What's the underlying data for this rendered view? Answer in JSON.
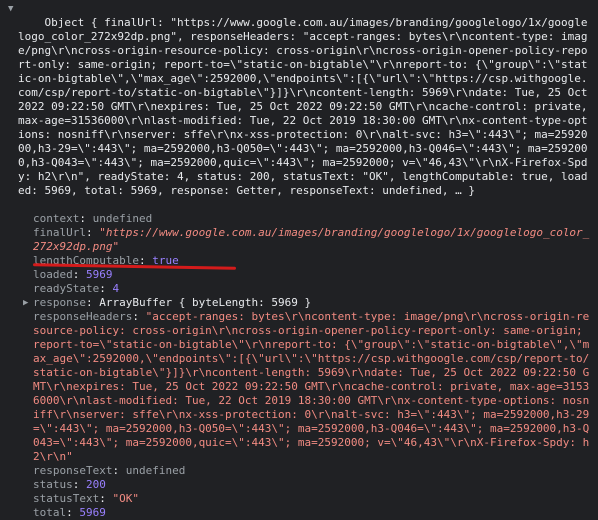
{
  "summary": {
    "text": "Object { finalUrl: \"https://www.google.com.au/images/branding/googlelogo/1x/googlelogo_color_272x92dp.png\", responseHeaders: \"accept-ranges: bytes\\r\\ncontent-type: image/png\\r\\ncross-origin-resource-policy: cross-origin\\r\\ncross-origin-opener-policy-report-only: same-origin; report-to=\\\"static-on-bigtable\\\"\\r\\nreport-to: {\\\"group\\\":\\\"static-on-bigtable\\\",\\\"max_age\\\":2592000,\\\"endpoints\\\":[{\\\"url\\\":\\\"https://csp.withgoogle.com/csp/report-to/static-on-bigtable\\\"}]}\\r\\ncontent-length: 5969\\r\\ndate: Tue, 25 Oct 2022 09:22:50 GMT\\r\\nexpires: Tue, 25 Oct 2022 09:22:50 GMT\\r\\ncache-control: private, max-age=31536000\\r\\nlast-modified: Tue, 22 Oct 2019 18:30:00 GMT\\r\\nx-content-type-options: nosniff\\r\\nserver: sffe\\r\\nx-xss-protection: 0\\r\\nalt-svc: h3=\\\":443\\\"; ma=2592000,h3-29=\\\":443\\\"; ma=2592000,h3-Q050=\\\":443\\\"; ma=2592000,h3-Q046=\\\":443\\\"; ma=2592000,h3-Q043=\\\":443\\\"; ma=2592000,quic=\\\":443\\\"; ma=2592000; v=\\\"46,43\\\"\\r\\nX-Firefox-Spdy: h2\\r\\n\", readyState: 4, status: 200, statusText: \"OK\", lengthComputable: true, loaded: 5969, total: 5969, response: Getter, responseText: undefined, … }"
  },
  "props": {
    "context": {
      "name": "context",
      "value": "undefined"
    },
    "finalUrl": {
      "name": "finalUrl",
      "value": "\"https://www.google.com.au/images/branding/googlelogo/1x/googlelogo_color_272x92dp.png\""
    },
    "lengthComputable": {
      "name": "lengthComputable",
      "value": "true"
    },
    "loaded": {
      "name": "loaded",
      "value": "5969"
    },
    "readyState": {
      "name": "readyState",
      "value": "4"
    },
    "response": {
      "name": "response",
      "value": "ArrayBuffer { byteLength: 5969 }"
    },
    "responseHeaders": {
      "name": "responseHeaders",
      "value": "\"accept-ranges: bytes\\r\\ncontent-type: image/png\\r\\ncross-origin-resource-policy: cross-origin\\r\\ncross-origin-opener-policy-report-only: same-origin; report-to=\\\"static-on-bigtable\\\"\\r\\nreport-to: {\\\"group\\\":\\\"static-on-bigtable\\\",\\\"max_age\\\":2592000,\\\"endpoints\\\":[{\\\"url\\\":\\\"https://csp.withgoogle.com/csp/report-to/static-on-bigtable\\\"}]}\\r\\ncontent-length: 5969\\r\\ndate: Tue, 25 Oct 2022 09:22:50 GMT\\r\\nexpires: Tue, 25 Oct 2022 09:22:50 GMT\\r\\ncache-control: private, max-age=31536000\\r\\nlast-modified: Tue, 22 Oct 2019 18:30:00 GMT\\r\\nx-content-type-options: nosniff\\r\\nserver: sffe\\r\\nx-xss-protection: 0\\r\\nalt-svc: h3=\\\":443\\\"; ma=2592000,h3-29=\\\":443\\\"; ma=2592000,h3-Q050=\\\":443\\\"; ma=2592000,h3-Q046=\\\":443\\\"; ma=2592000,h3-Q043=\\\":443\\\"; ma=2592000,quic=\\\":443\\\"; ma=2592000; v=\\\"46,43\\\"\\r\\nX-Firefox-Spdy: h2\\r\\n\""
    },
    "responseText": {
      "name": "responseText",
      "value": "undefined"
    },
    "status": {
      "name": "status",
      "value": "200"
    },
    "statusText": {
      "name": "statusText",
      "value": "\"OK\""
    },
    "total": {
      "name": "total",
      "value": "5969"
    }
  },
  "colors": {
    "background": "#202124",
    "string": "#f28b82",
    "number": "#9980ff",
    "key": "#5db0d7",
    "underline": "#d41b1b"
  },
  "icons": {
    "expanded": "triangle-down-icon",
    "collapsed": "triangle-right-icon"
  }
}
